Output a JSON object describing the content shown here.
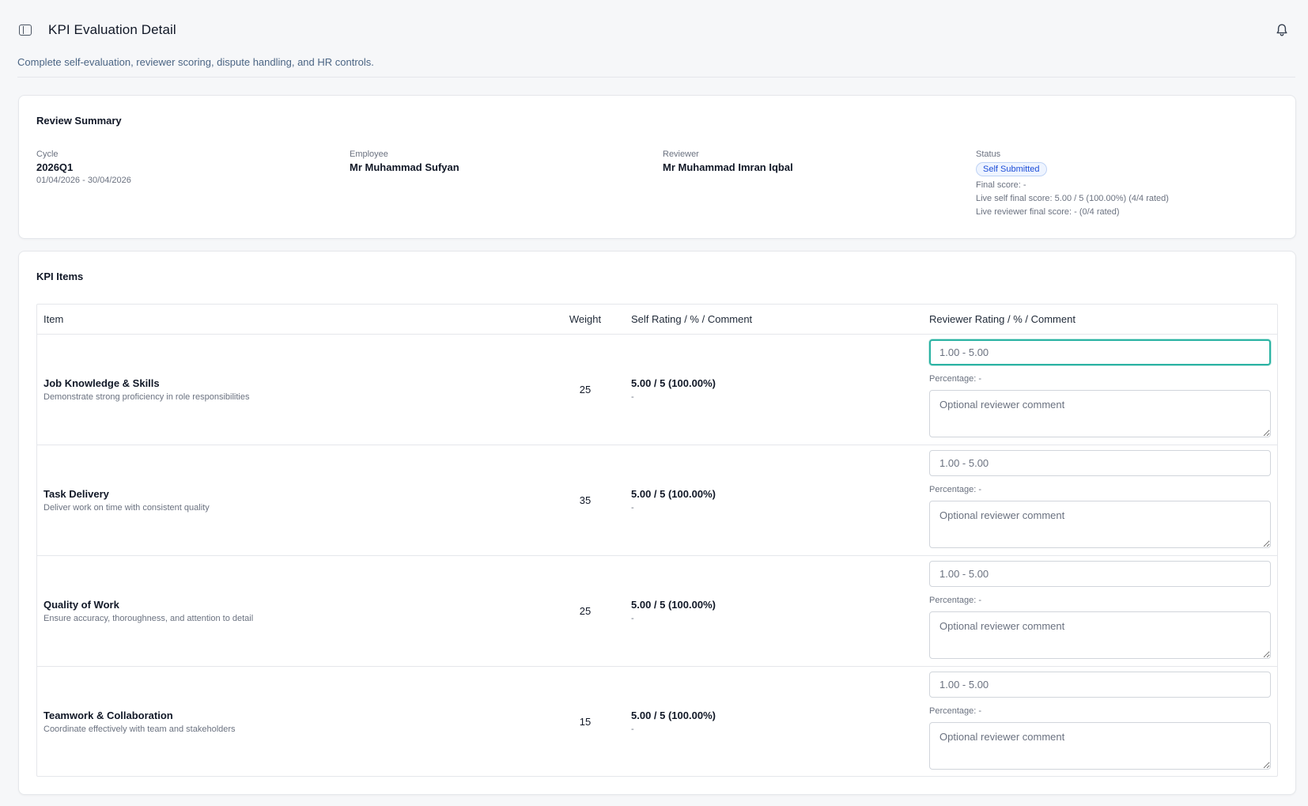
{
  "header": {
    "title": "KPI Evaluation Detail",
    "subtitle": "Complete self-evaluation, reviewer scoring, dispute handling, and HR controls."
  },
  "summary": {
    "title": "Review Summary",
    "cycle": {
      "label": "Cycle",
      "value": "2026Q1",
      "dates": "01/04/2026 - 30/04/2026"
    },
    "employee": {
      "label": "Employee",
      "value": "Mr Muhammad Sufyan"
    },
    "reviewer": {
      "label": "Reviewer",
      "value": "Mr Muhammad Imran Iqbal"
    },
    "status": {
      "label": "Status",
      "badge": "Self Submitted",
      "badge_color": "#1d4ed8",
      "final_score": "Final score: -",
      "live_self": "Live self final score: 5.00 / 5 (100.00%) (4/4 rated)",
      "live_reviewer": "Live reviewer final score: - (0/4 rated)"
    }
  },
  "kpi": {
    "title": "KPI Items",
    "columns": {
      "item": "Item",
      "weight": "Weight",
      "self": "Self Rating / % / Comment",
      "reviewer": "Reviewer Rating / % / Comment"
    },
    "rating_placeholder": "1.00 - 5.00",
    "comment_placeholder": "Optional reviewer comment",
    "items": [
      {
        "name": "Job Knowledge & Skills",
        "description": "Demonstrate strong proficiency in role responsibilities",
        "weight": "25",
        "self_rating": "5.00 / 5 (100.00%)",
        "self_comment": "-",
        "percentage": "Percentage: -"
      },
      {
        "name": "Task Delivery",
        "description": "Deliver work on time with consistent quality",
        "weight": "35",
        "self_rating": "5.00 / 5 (100.00%)",
        "self_comment": "-",
        "percentage": "Percentage: -"
      },
      {
        "name": "Quality of Work",
        "description": "Ensure accuracy, thoroughness, and attention to detail",
        "weight": "25",
        "self_rating": "5.00 / 5 (100.00%)",
        "self_comment": "-",
        "percentage": "Percentage: -"
      },
      {
        "name": "Teamwork & Collaboration",
        "description": "Coordinate effectively with team and stakeholders",
        "weight": "15",
        "self_rating": "5.00 / 5 (100.00%)",
        "self_comment": "-",
        "percentage": "Percentage: -"
      }
    ]
  },
  "icons": {
    "sidebar_toggle": "sidebar-toggle-icon",
    "notifications": "bell-icon"
  },
  "colors": {
    "focus_ring": "#2bb3a3",
    "badge_bg": "#eef4ff"
  }
}
